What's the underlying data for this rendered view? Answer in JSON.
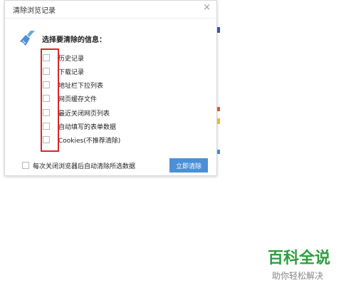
{
  "dialog": {
    "title": "清除浏览记录",
    "close_glyph": "×",
    "heading": "选择要清除的信息：",
    "options": [
      {
        "label": "历史记录",
        "checked": false
      },
      {
        "label": "下载记录",
        "checked": false
      },
      {
        "label": "地址栏下拉列表",
        "checked": false
      },
      {
        "label": "网页缓存文件",
        "checked": false
      },
      {
        "label": "最近关闭网页列表",
        "checked": false
      },
      {
        "label": "自动填写的表单数据",
        "checked": false
      },
      {
        "label": "Cookies(不推荐清除)",
        "checked": false
      }
    ],
    "auto_clear_label": "每次关闭浏览器后自动清除所选数据",
    "auto_clear_checked": false,
    "clear_button_label": "立即清除"
  },
  "watermark": {
    "title": "百科全说",
    "subtitle": "助你轻松解决"
  },
  "colors": {
    "accent": "#4b8fd6",
    "highlight": "#d9262c",
    "watermark": "#2e9e3e"
  }
}
